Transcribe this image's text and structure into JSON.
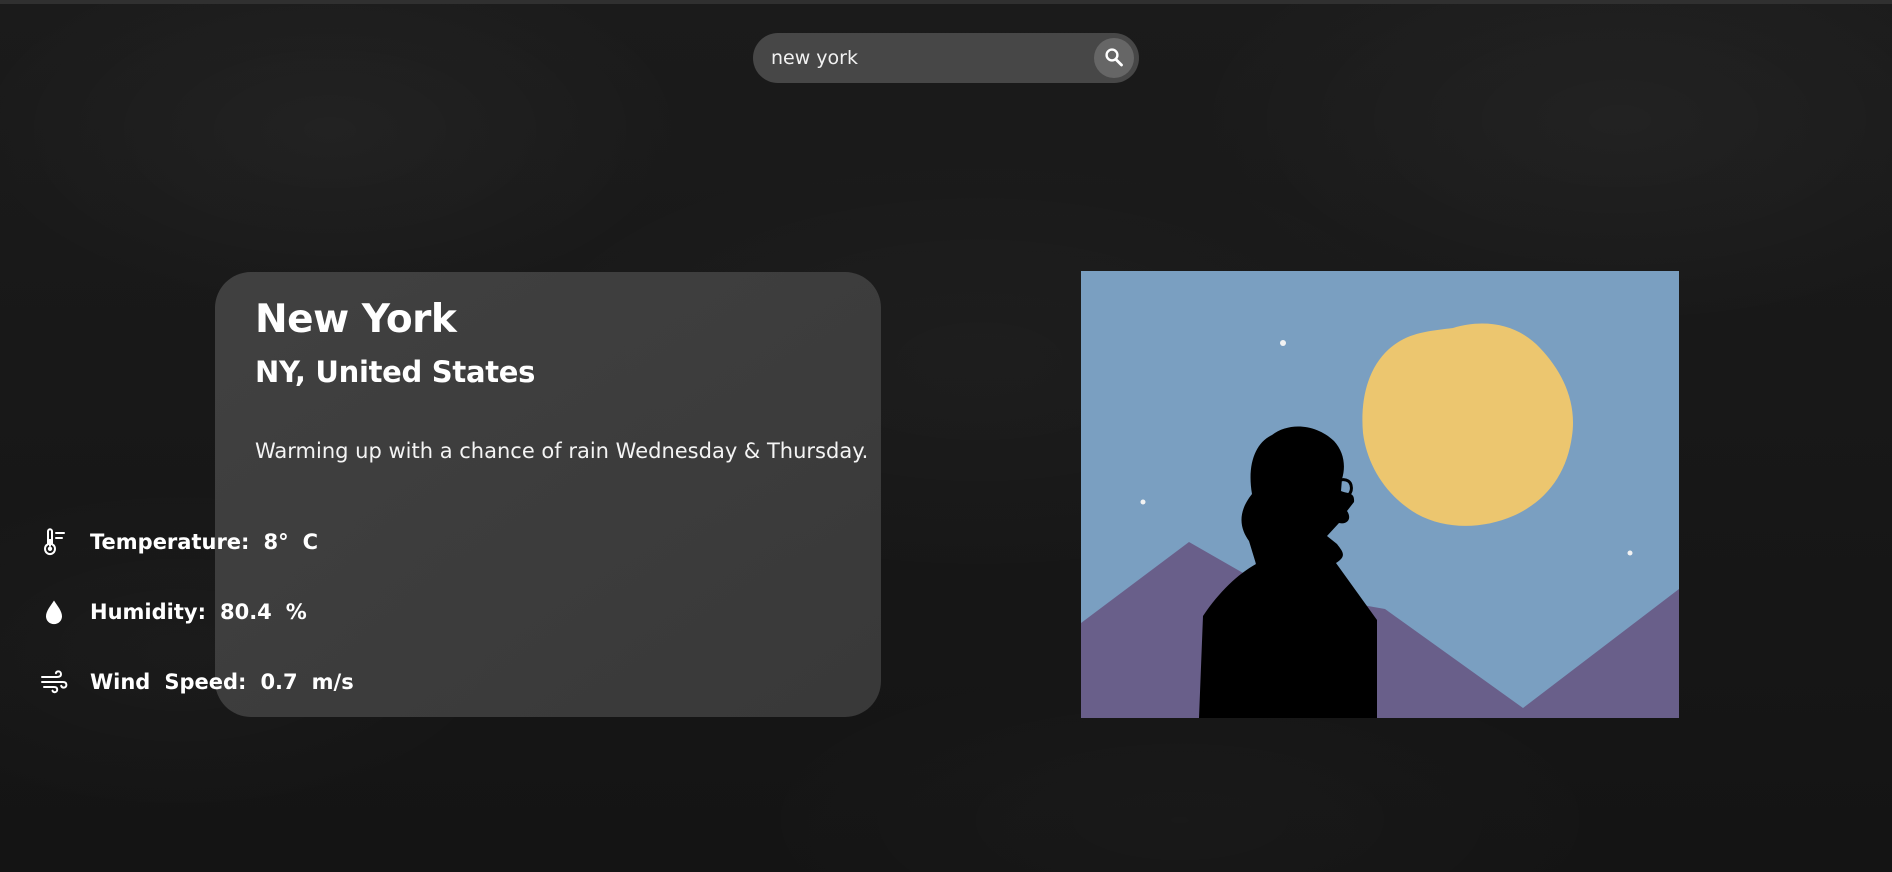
{
  "search": {
    "value": "new york"
  },
  "location": {
    "city": "New York",
    "region": "NY, United States"
  },
  "forecast": "Warming up with a chance of rain Wednesday & Thursday.",
  "stats": {
    "temperature": {
      "label": "Temperature:",
      "value": "8°",
      "unit": "C",
      "icon": "thermometer-icon"
    },
    "humidity": {
      "label": "Humidity:",
      "value": "80.4",
      "unit": "%",
      "icon": "water-drop-icon"
    },
    "wind_speed": {
      "label_word1": "Wind",
      "label_word2": "Speed:",
      "value": "0.7",
      "unit": "m/s",
      "icon": "wind-icon"
    }
  },
  "icons": {
    "search": "search-icon"
  },
  "colors": {
    "background": "#161616",
    "card": "#3f3f3f",
    "search_bar": "#474747",
    "search_button": "#666666",
    "sky": "#7a9fc1",
    "moon": "#ecc66f",
    "mountains": "#695f8a",
    "silhouette": "#000000"
  }
}
